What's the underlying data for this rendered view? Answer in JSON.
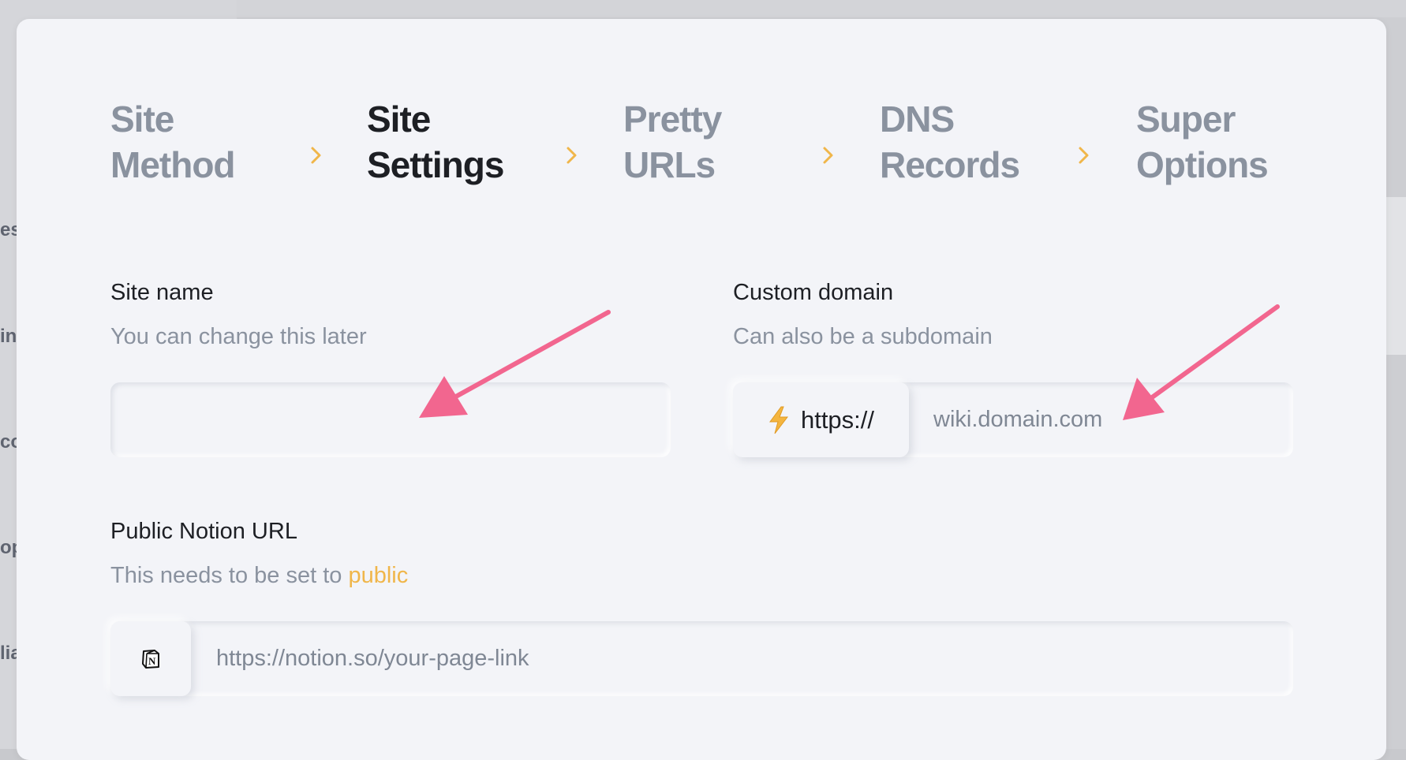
{
  "background": {
    "sidebar_peek": [
      "es",
      "in",
      "co",
      "op",
      "lia"
    ]
  },
  "stepper": {
    "steps": [
      {
        "line1": "Site",
        "line2": "Method",
        "active": false
      },
      {
        "line1": "Site",
        "line2": "Settings",
        "active": true
      },
      {
        "line1": "Pretty",
        "line2": "URLs",
        "active": false
      },
      {
        "line1": "DNS",
        "line2": "Records",
        "active": false
      },
      {
        "line1": "Super",
        "line2": "Options",
        "active": false
      }
    ],
    "chevron_icon": "chevron-right-icon"
  },
  "site_name": {
    "label": "Site name",
    "help": "You can change this later",
    "value": "",
    "placeholder": ""
  },
  "custom_domain": {
    "label": "Custom domain",
    "help": "Can also be a subdomain",
    "prefix_icon": "lightning-bolt-icon",
    "prefix_text": "https://",
    "value": "",
    "placeholder": "wiki.domain.com"
  },
  "notion_url": {
    "label": "Public Notion URL",
    "help_prefix": "This needs to be set to ",
    "help_accent": "public",
    "prefix_icon": "notion-logo-icon",
    "value": "",
    "placeholder": "https://notion.so/your-page-link"
  },
  "colors": {
    "modal_bg": "#f3f4f8",
    "inactive_step": "#8a929f",
    "active_step": "#1d1f24",
    "accent": "#f0b64a",
    "annotation_arrow": "#f2668f"
  }
}
